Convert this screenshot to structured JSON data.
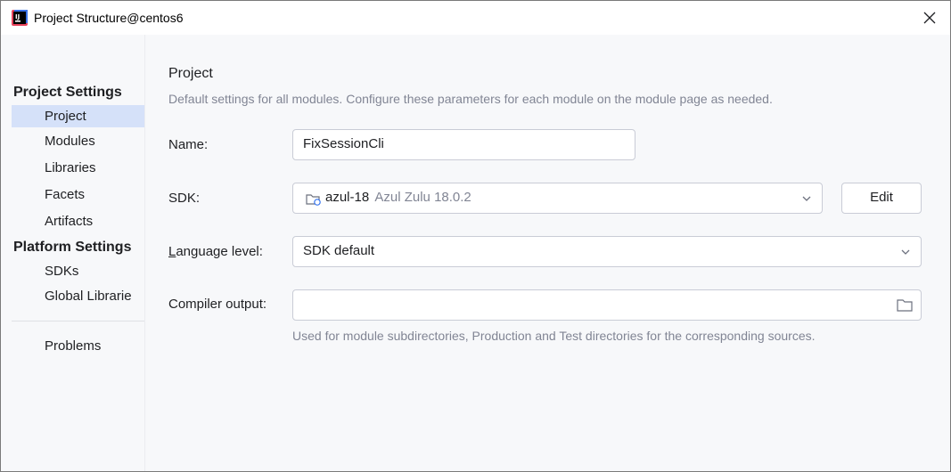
{
  "window": {
    "title": "Project Structure@centos6"
  },
  "nav": {
    "back_glyph": "←",
    "forward_glyph": "→"
  },
  "sidebar": {
    "project_settings_header": "Project Settings",
    "project_items": [
      "Project",
      "Modules",
      "Libraries",
      "Facets",
      "Artifacts"
    ],
    "platform_settings_header": "Platform Settings",
    "platform_items": [
      "SDKs",
      "Global Librarie"
    ],
    "problems": "Problems",
    "selected": "Project"
  },
  "main": {
    "title": "Project",
    "description": "Default settings for all modules. Configure these parameters for each module on the module page as needed.",
    "name": {
      "label": "Name:",
      "value": "FixSessionCli"
    },
    "sdk": {
      "label": "SDK:",
      "name": "azul-18",
      "detail": "Azul Zulu 18.0.2",
      "edit_label": "Edit"
    },
    "language_level": {
      "label_first": "L",
      "label_rest": "anguage level:",
      "value": "SDK default"
    },
    "compiler_output": {
      "label": "Compiler output:",
      "value": "",
      "hint": "Used for module subdirectories, Production and Test directories for the corresponding sources."
    }
  },
  "colors": {
    "selection": "#d5e1f9",
    "accent": "#3574f0",
    "muted_text": "#818594"
  }
}
